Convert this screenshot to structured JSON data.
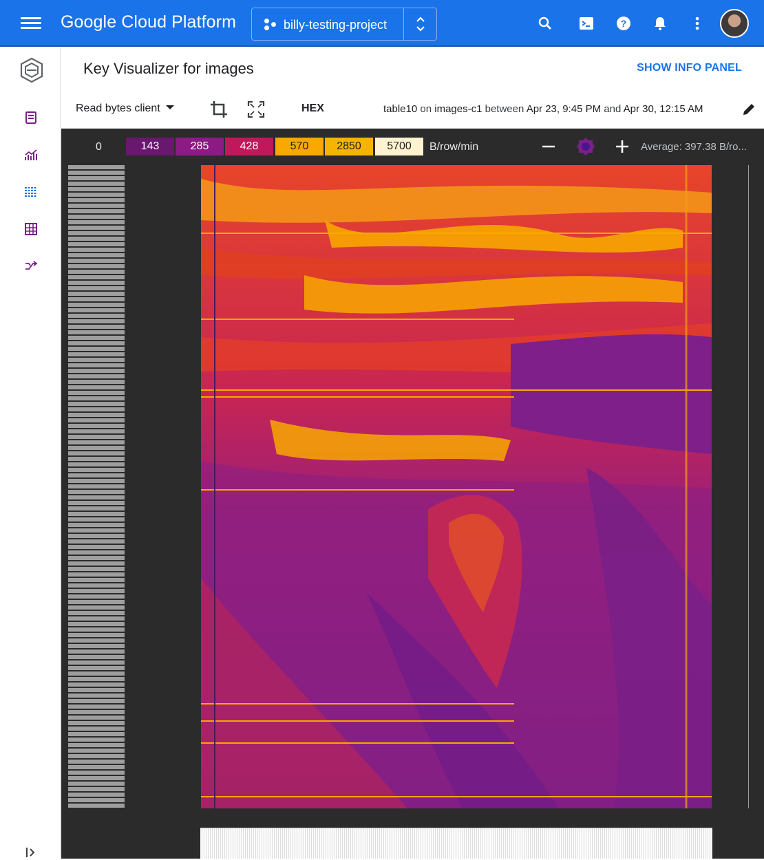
{
  "topbar": {
    "brand": "Google Cloud Platform",
    "project_name": "billy-testing-project"
  },
  "icons": {
    "menu": "hamburger-menu-icon",
    "search": "search-icon",
    "cloud_shell": "cloud-shell-icon",
    "help": "help-icon",
    "notifications": "bell-icon",
    "more": "more-vert-icon"
  },
  "header": {
    "title": "Key Visualizer for images",
    "info_panel_link": "SHOW INFO PANEL"
  },
  "toolbar": {
    "metric_select": "Read bytes client",
    "hex_toggle": "HEX",
    "range_prefix": "table10",
    "range_on": "on",
    "range_instance": "images-c1",
    "range_between": "between",
    "range_start": "Apr 23, 9:45 PM",
    "range_and": "and",
    "range_end": "Apr 30, 12:15 AM"
  },
  "legend": {
    "zero_label": "0",
    "stops": [
      {
        "label": "143",
        "color": "#6a1770"
      },
      {
        "label": "285",
        "color": "#8e1a86"
      },
      {
        "label": "428",
        "color": "#c2185b"
      },
      {
        "label": "570",
        "color": "#f9a800"
      },
      {
        "label": "2850",
        "color": "#f5b400"
      },
      {
        "label": "5700",
        "color": "#fff3d0"
      }
    ],
    "unit": "B/row/min",
    "average": "Average: 397.38 B/ro..."
  },
  "colors": {
    "accent": "#1a73e8",
    "heat_low": "#7b1f8a",
    "heat_mid": "#e0342f",
    "heat_high": "#f9a800"
  }
}
